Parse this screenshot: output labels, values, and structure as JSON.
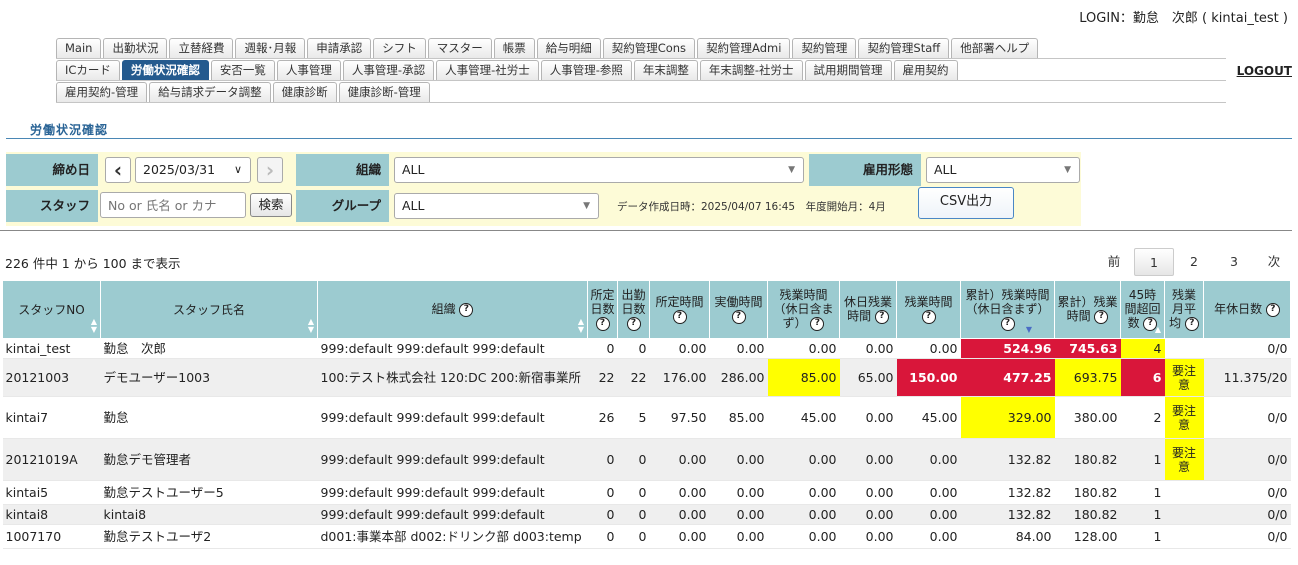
{
  "header": {
    "login_text": "LOGIN：勤怠　次郎 ( kintai_test )",
    "logout_label": "LOGOUT"
  },
  "nav": {
    "row1": [
      "Main",
      "出勤状況",
      "立替経費",
      "週報･月報",
      "申請承認",
      "シフト",
      "マスター",
      "帳票",
      "給与明細",
      "契約管理Cons",
      "契約管理Admi",
      "契約管理",
      "契約管理Staff",
      "他部署ヘルプ"
    ],
    "row2": [
      "ICカード",
      "労働状況確認",
      "安否一覧",
      "人事管理",
      "人事管理-承認",
      "人事管理-社労士",
      "人事管理-参照",
      "年末調整",
      "年末調整-社労士",
      "試用期間管理",
      "雇用契約"
    ],
    "row3": [
      "雇用契約-管理",
      "給与請求データ調整",
      "健康診断",
      "健康診断-管理"
    ],
    "active": "労働状況確認"
  },
  "page_title": "労働状況確認",
  "filters": {
    "closing_label": "締め日",
    "date_value": "2025/03/31",
    "org_label": "組織",
    "org_value": "ALL",
    "emp_type_label": "雇用形態",
    "emp_type_value": "ALL",
    "staff_label": "スタッフ",
    "staff_placeholder": "No or 氏名 or カナ",
    "search_label": "検索",
    "group_label": "グループ",
    "group_value": "ALL",
    "meta": "データ作成日時：2025/04/07 16:45　年度開始月：4月",
    "csv_label": "CSV出力"
  },
  "count_text": "226 件中 1 から 100 まで表示",
  "pager": {
    "prev": "前",
    "pages": [
      "1",
      "2",
      "3"
    ],
    "current": "1",
    "next": "次"
  },
  "table": {
    "headers": [
      "スタッフNO",
      "スタッフ氏名",
      "組織",
      "所定日数",
      "出勤日数",
      "所定時間",
      "実働時間",
      "残業時間（休日含まず）",
      "休日残業時間",
      "残業時間",
      "累計）残業時間（休日含まず）",
      "累計）残業時間",
      "45時間超回数",
      "残業月平均",
      "年休日数"
    ],
    "rows": [
      [
        "kintai_test",
        "勤怠　次郎",
        "999:default 999:default 999:default",
        "0",
        "0",
        "0.00",
        "0.00",
        "0.00",
        "0.00",
        "0.00",
        "524.96",
        "745.63",
        "4",
        "",
        "0/0"
      ],
      [
        "20121003",
        "デモユーザー1003",
        "100:テスト株式会社 120:DC 200:新宿事業所",
        "22",
        "22",
        "176.00",
        "286.00",
        "85.00",
        "65.00",
        "150.00",
        "477.25",
        "693.75",
        "6",
        "要注意",
        "11.375/20"
      ],
      [
        "kintai7",
        "勤怠",
        "999:default 999:default 999:default",
        "26",
        "5",
        "97.50",
        "85.00",
        "45.00",
        "0.00",
        "45.00",
        "329.00",
        "380.00",
        "2",
        "要注意",
        "0/0"
      ],
      [
        "20121019A",
        "勤怠デモ管理者",
        "999:default 999:default 999:default",
        "0",
        "0",
        "0.00",
        "0.00",
        "0.00",
        "0.00",
        "0.00",
        "132.82",
        "180.82",
        "1",
        "要注意",
        "0/0"
      ],
      [
        "kintai5",
        "勤怠テストユーザー5",
        "999:default 999:default 999:default",
        "0",
        "0",
        "0.00",
        "0.00",
        "0.00",
        "0.00",
        "0.00",
        "132.82",
        "180.82",
        "1",
        "",
        "0/0"
      ],
      [
        "kintai8",
        "kintai8",
        "999:default 999:default 999:default",
        "0",
        "0",
        "0.00",
        "0.00",
        "0.00",
        "0.00",
        "0.00",
        "132.82",
        "180.82",
        "1",
        "",
        "0/0"
      ],
      [
        "1007170",
        "勤怠テストユーザ2",
        "d001:事業本部 d002:ドリンク部 d003:temp",
        "0",
        "0",
        "0.00",
        "0.00",
        "0.00",
        "0.00",
        "0.00",
        "84.00",
        "128.00",
        "1",
        "",
        "0/0"
      ]
    ],
    "highlights": [
      {
        "row": 0,
        "col": 10,
        "color": "red"
      },
      {
        "row": 0,
        "col": 11,
        "color": "red"
      },
      {
        "row": 0,
        "col": 12,
        "color": "yellow"
      },
      {
        "row": 1,
        "col": 7,
        "color": "yellow"
      },
      {
        "row": 1,
        "col": 9,
        "color": "red"
      },
      {
        "row": 1,
        "col": 10,
        "color": "red"
      },
      {
        "row": 1,
        "col": 11,
        "color": "yellow"
      },
      {
        "row": 1,
        "col": 12,
        "color": "red"
      },
      {
        "row": 1,
        "col": 13,
        "color": "yellow"
      },
      {
        "row": 2,
        "col": 10,
        "color": "yellow"
      },
      {
        "row": 2,
        "col": 13,
        "color": "yellow"
      },
      {
        "row": 3,
        "col": 13,
        "color": "yellow"
      }
    ]
  },
  "colors": {
    "header_bg": "#9ccbd0",
    "active_tab": "#245a8e",
    "alert_red": "#d9163a",
    "alert_yellow": "#ffff00",
    "filter_bg": "#fdfbd7"
  }
}
